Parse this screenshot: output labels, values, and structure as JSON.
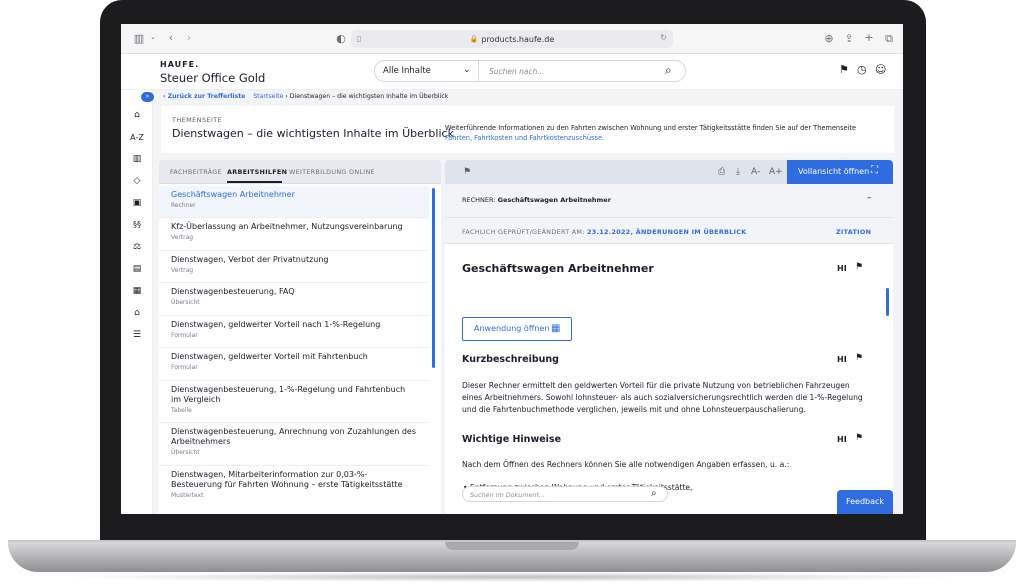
{
  "browser": {
    "url": "products.haufe.de"
  },
  "app": {
    "logo": "HAUFE.",
    "product": "Steuer Office Gold"
  },
  "search": {
    "scope": "Alle Inhalte",
    "placeholder": "Suchen nach..."
  },
  "rail": {
    "items": [
      {
        "icon": "home-icon",
        "glyph": "⌂"
      },
      {
        "icon": "a-z-icon",
        "glyph": "A-Z"
      },
      {
        "icon": "book-icon",
        "glyph": "📖"
      },
      {
        "icon": "tag-icon",
        "glyph": "🏷"
      },
      {
        "icon": "id-card-icon",
        "glyph": "▣"
      },
      {
        "icon": "paragraph-icon",
        "glyph": "§§"
      },
      {
        "icon": "scale-icon",
        "glyph": "⚖"
      },
      {
        "icon": "chart-doc-icon",
        "glyph": "▤"
      },
      {
        "icon": "calculator-doc-icon",
        "glyph": "▦"
      },
      {
        "icon": "graduation-cap-icon",
        "glyph": "🎓"
      },
      {
        "icon": "checklist-icon",
        "glyph": "☰"
      }
    ]
  },
  "breadcrumb": {
    "back": "Zurück zur Trefferliste",
    "home": "Startseite",
    "current": "Dienstwagen – die wichtigsten Inhalte im Überblick"
  },
  "topic": {
    "kicker": "THEMENSEITE",
    "title": "Dienstwagen – die wichtigsten Inhalte im Überblick",
    "info": "Weiterführende Informationen zu den Fahrten zwischen Wohnung und erster Tätigkeitsstätte finden Sie auf der Themenseite",
    "links": "Fahrten, Fahrtkosten und Fahrtkostenzuschüsse."
  },
  "tabs": [
    "FACHBEITRÄGE",
    "ARBEITSHILFEN",
    "WEITERBILDUNG ONLINE"
  ],
  "list": [
    {
      "title": "Geschäftswagen Arbeitnehmer",
      "sub": "Rechner"
    },
    {
      "title": "Kfz-Überlassung an Arbeitnehmer, Nutzungsvereinbarung",
      "sub": "Vertrag"
    },
    {
      "title": "Dienstwagen, Verbot der Privatnutzung",
      "sub": "Vertrag"
    },
    {
      "title": "Dienstwagenbesteuerung, FAQ",
      "sub": "Übersicht"
    },
    {
      "title": "Dienstwagen, geldwerter Vorteil nach 1-%-Regelung",
      "sub": "Formular"
    },
    {
      "title": "Dienstwagen, geldwerter Vorteil mit Fahrtenbuch",
      "sub": "Formular"
    },
    {
      "title": "Dienstwagenbesteuerung, 1-%-Regelung und Fahrtenbuch im Vergleich",
      "sub": "Tabelle"
    },
    {
      "title": "Dienstwagenbesteuerung, Anrechnung von Zuzahlungen des Arbeitnehmers",
      "sub": "Übersicht"
    },
    {
      "title": "Dienstwagen, Mitarbeiterinformation zur 0,03-%-Besteuerung für Fahrten Wohnung – erste Tätigkeitsstätte",
      "sub": "Mustertext"
    }
  ],
  "doc": {
    "open_full": "Vollansicht öffnen",
    "rechner_label": "RECHNER:",
    "rechner_name": "Geschäftswagen Arbeitnehmer",
    "checked": "FACHLICH GEPRÜFT/GEÄNDERT AM:",
    "checked_date": "23.12.2022, ÄNDERUNGEN IM ÜBERBLICK",
    "citation": "ZITATION",
    "title": "Geschäftswagen Arbeitnehmer",
    "open_app": "Anwendung öffnen",
    "h_short": "Kurzbeschreibung",
    "p_short": "Dieser Rechner ermittelt den geldwerten Vorteil für die private Nutzung von betrieblichen Fahrzeugen eines Arbeitnehmers. Sowohl lohnsteuer- als auch sozialversicherungsrechtlich werden die 1-%-Regelung und die Fahrtenbuchmethode verglichen, jeweils mit und ohne Lohnsteuerpauschalierung.",
    "h_notes": "Wichtige Hinweise",
    "p_notes": "Nach dem Öffnen des Rechners können Sie alle notwendigen Angaben erfassen, u. a.:",
    "bullet1": "Entfernung zwischen Wohnung und erster Tätigkeitsstätte,",
    "hi": "HI",
    "doc_search": "Suchen im Dokument..."
  },
  "feedback": "Feedback",
  "colors": {
    "accent": "#2f6ce0"
  }
}
